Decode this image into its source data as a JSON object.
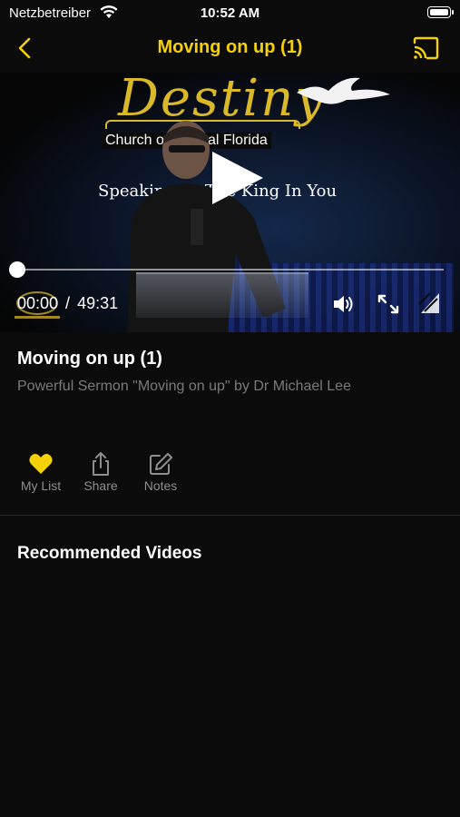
{
  "status_bar": {
    "carrier": "Netzbetreiber",
    "time": "10:52 AM",
    "battery_level": 1.0
  },
  "nav": {
    "title": "Moving on up (1)",
    "accent_color": "#f5d10a",
    "back_icon": "chevron-left-icon",
    "cast_icon": "cast-icon"
  },
  "player": {
    "thumbnail": {
      "logo_text": "Destiny",
      "church_text": "Church of Central Florida",
      "tagline": "Speaking To The King In You"
    },
    "current_time": "00:00",
    "separator": "/",
    "duration": "49:31",
    "progress": 0.0
  },
  "video": {
    "title": "Moving on up (1)",
    "description": "Powerful Sermon \"Moving on up\" by Dr Michael Lee"
  },
  "actions": [
    {
      "label": "My List",
      "icon": "heart-icon",
      "color": "#f5d10a"
    },
    {
      "label": "Share",
      "icon": "share-icon"
    },
    {
      "label": "Notes",
      "icon": "notes-edit-icon"
    }
  ],
  "recommended": {
    "title": "Recommended Videos"
  }
}
